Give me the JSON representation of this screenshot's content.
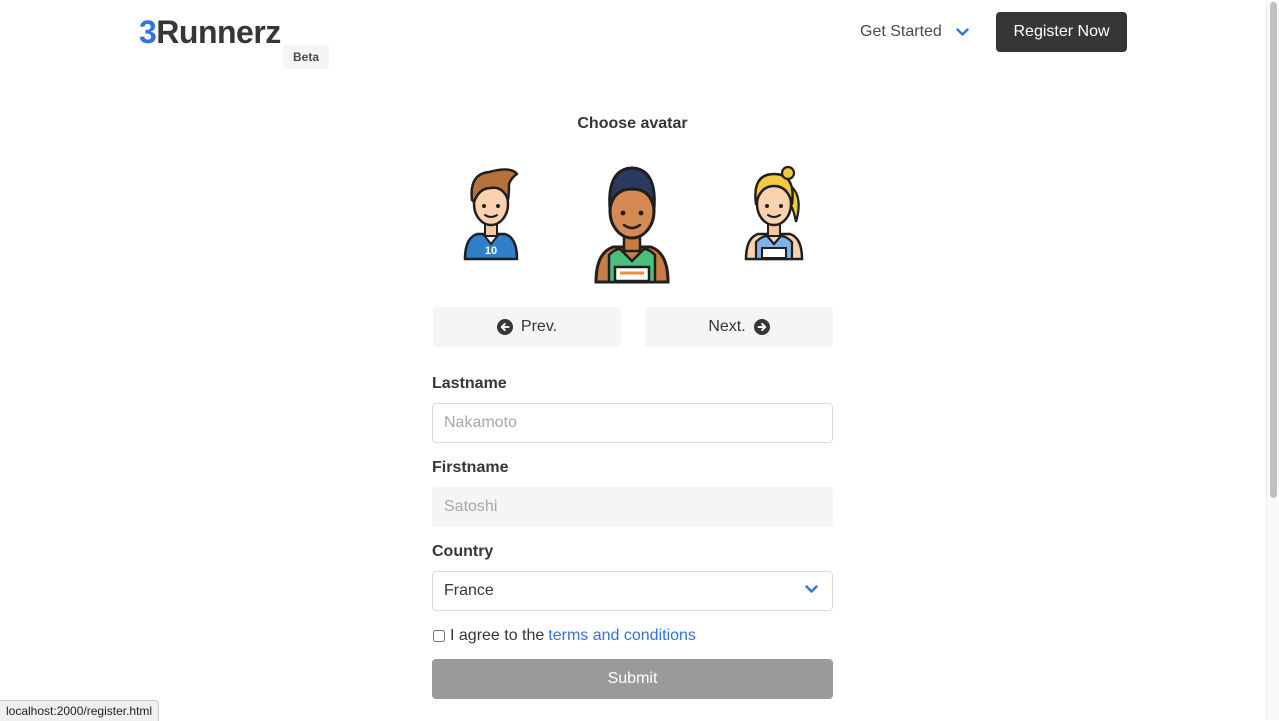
{
  "navbar": {
    "brand_digit": "3",
    "brand_text": "Runnerz",
    "beta_tag": "Beta",
    "dropdown_label": "Get Started",
    "register_button": "Register Now"
  },
  "avatar_picker": {
    "title": "Choose avatar",
    "avatars": [
      {
        "name": "soccer-player-boy",
        "jersey_number": "10",
        "selected": false
      },
      {
        "name": "runner-man",
        "selected": true
      },
      {
        "name": "runner-girl",
        "selected": false
      }
    ],
    "prev_label": "Prev.",
    "next_label": "Next."
  },
  "form": {
    "lastname_label": "Lastname",
    "lastname_placeholder": "Nakamoto",
    "firstname_label": "Firstname",
    "firstname_placeholder": "Satoshi",
    "country_label": "Country",
    "country_value": "France",
    "agree_prefix": "I agree to the",
    "terms_link": "terms and conditions",
    "submit_label": "Submit"
  },
  "status_bar": {
    "url": "localhost:2000/register.html"
  },
  "colors": {
    "accent": "#3273dc",
    "dark": "#363636",
    "light": "#f5f5f5",
    "disabled": "#9a9a9a"
  },
  "icons": [
    "chevron-down-icon",
    "arrow-left-circle-icon",
    "arrow-right-circle-icon"
  ]
}
